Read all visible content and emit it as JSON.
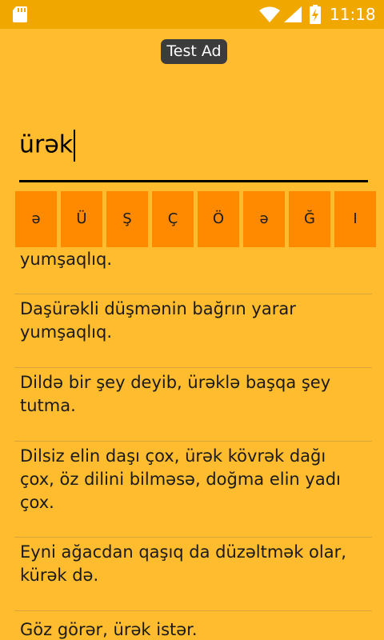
{
  "status_bar": {
    "time": "11:18",
    "icons": [
      "sd-card-icon",
      "wifi-icon",
      "cell-signal-icon",
      "battery-charging-icon"
    ]
  },
  "ad_banner": {
    "label": "Test Ad"
  },
  "search": {
    "value": "ürək"
  },
  "special_keys": [
    "ə",
    "Ü",
    "Ş",
    "Ç",
    "Ö",
    "ə",
    "Ğ",
    "I"
  ],
  "proverbs": [
    "yumşaqlıq.",
    "Daşürəkli düşmənin bağrın yarar yumşaqlıq.",
    "Dildə bir şey deyib, ürəklə başqa şey tutma.",
    "Dilsiz elin daşı çox, ürək kövrək dağı çox, öz dilini bilməsə, doğma elin yadı çox.",
    "Eyni ağacdan qaşıq da düzəltmək olar, kürək də.",
    "Göz görər, ürək istər."
  ],
  "colors": {
    "background": "#FFBC2F",
    "status_bar": "#F0A800",
    "key_background": "#FF8A00",
    "ad_background": "#3C3C3C"
  }
}
